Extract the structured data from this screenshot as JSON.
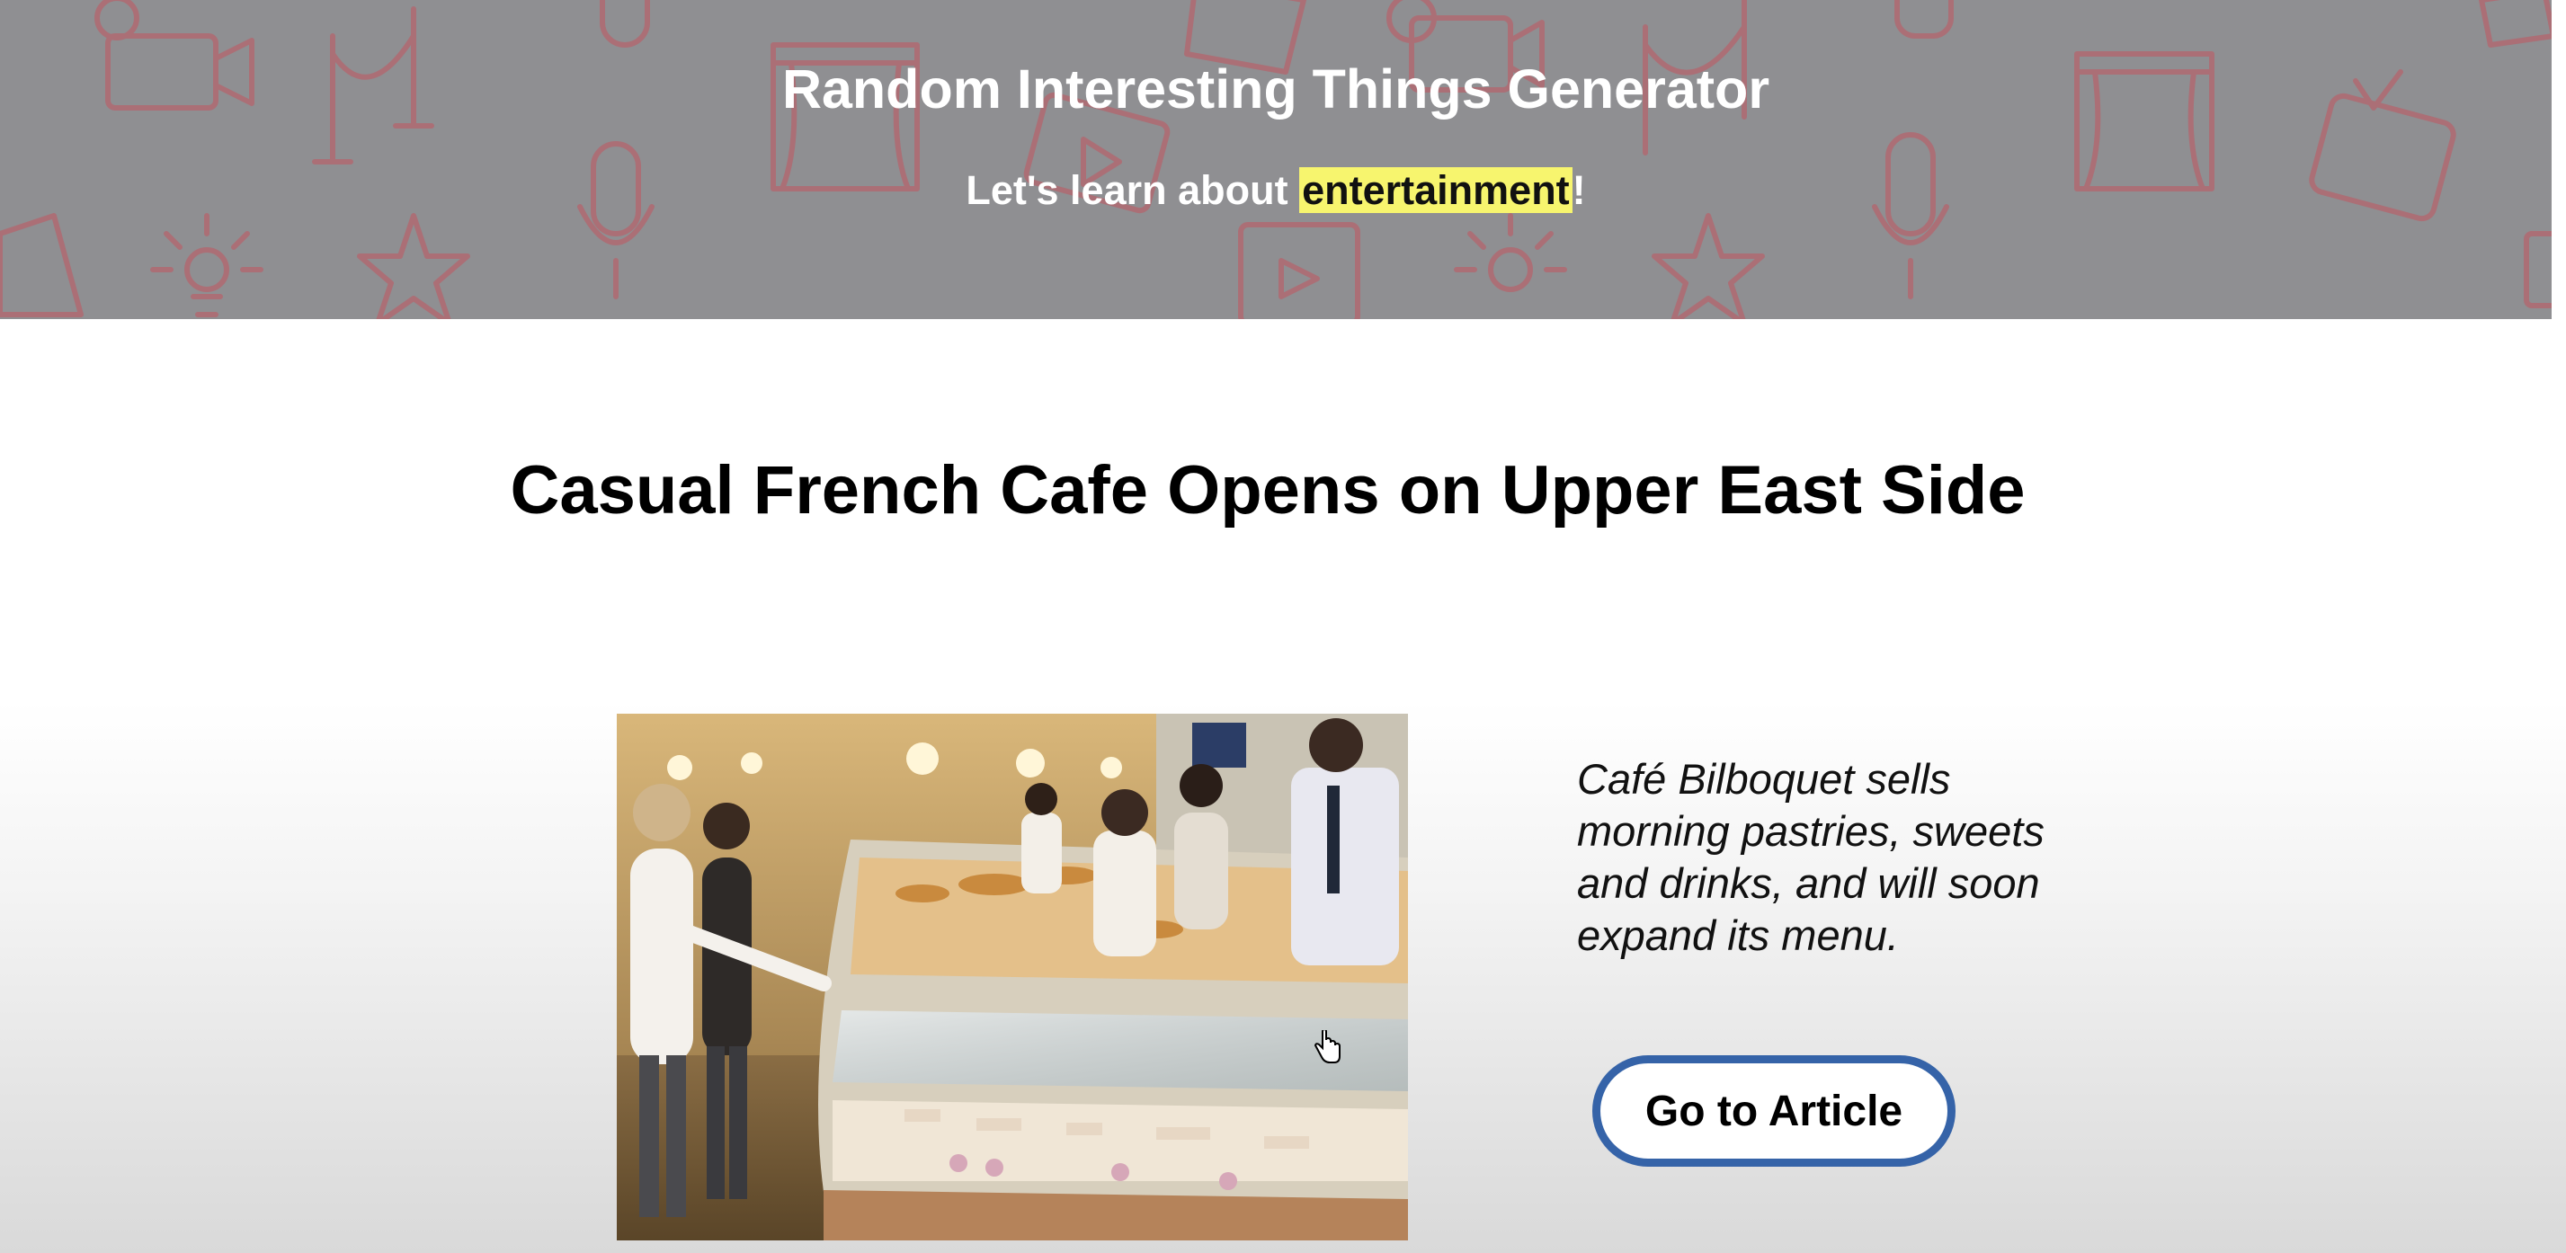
{
  "header": {
    "title": "Random Interesting Things Generator",
    "subtitle_prefix": "Let's learn about ",
    "subtitle_topic": "entertainment",
    "subtitle_suffix": "!",
    "background_color": "#8f8f92",
    "pattern_color": "#b06a72",
    "pattern_icons": [
      "film-camera-icon",
      "velvet-rope-icon",
      "microphone-icon",
      "star-icon",
      "spotlight-icon",
      "theater-curtain-icon",
      "television-icon",
      "video-player-icon",
      "clapperboard-icon"
    ],
    "highlight_color": "#f7f56e"
  },
  "article": {
    "title": "Casual French Cafe Opens on Upper East Side",
    "image_icon": "cafe-pastry-counter-photo",
    "summary": "Café Bilboquet sells morning pastries, sweets and drinks, and will soon expand its menu.",
    "button_label": "Go to Article",
    "button_border_color": "#3563a8"
  }
}
